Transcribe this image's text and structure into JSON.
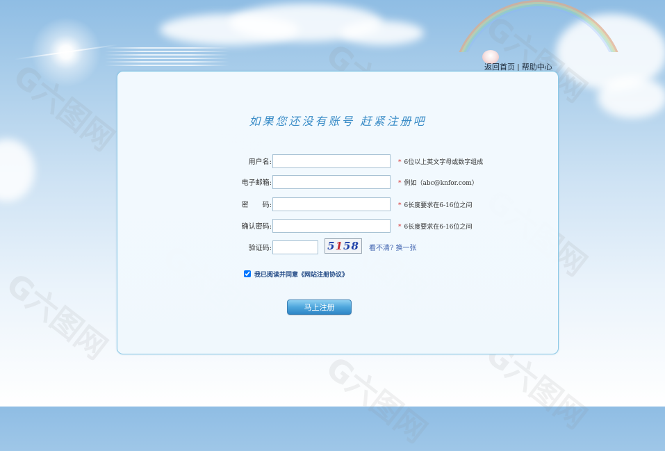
{
  "header": {
    "home_link": "返回首页",
    "separator": "|",
    "help_link": "帮助中心"
  },
  "form": {
    "title": "如果您还没有账号  赶紧注册吧",
    "fields": [
      {
        "label": "用户名:",
        "value": "",
        "hint": "6位以上英文字母或数字组成"
      },
      {
        "label": "电子邮箱:",
        "value": "",
        "hint": "例如（abc@knfor.com）"
      },
      {
        "label": "密　　码:",
        "value": "",
        "hint": "6长度要求在6-16位之间"
      },
      {
        "label": "确认密码:",
        "value": "",
        "hint": "6长度要求在6-16位之间"
      }
    ],
    "captcha": {
      "label": "验证码:",
      "value": "",
      "code": [
        "5",
        "1",
        "5",
        "8"
      ],
      "refresh_link": "看不清? 换一张"
    },
    "agreement": {
      "checked": true,
      "text": "我已阅读并同意《网站注册协议》"
    },
    "submit_label": "马上注册",
    "required_mark": "*"
  },
  "watermark": "G六图网",
  "colors": {
    "title": "#3a8cc7",
    "panel_border": "#8cc9e6",
    "required": "#d62b2b",
    "button": "#4da6dc",
    "link": "#4063b0"
  }
}
